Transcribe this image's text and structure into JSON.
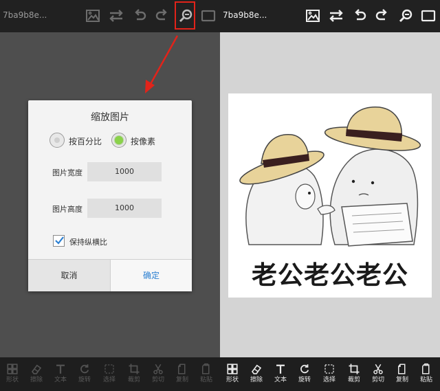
{
  "left_panel": {
    "file_name": "7ba9b8e...",
    "dialog": {
      "title": "缩放图片",
      "radio_percent_label": "按百分比",
      "radio_pixel_label": "按像素",
      "selected_mode": "按像素",
      "width_label": "图片宽度",
      "width_value": "1000",
      "height_label": "图片高度",
      "height_value": "1000",
      "keep_ratio_label": "保持纵横比",
      "keep_ratio_checked": true,
      "cancel_label": "取消",
      "ok_label": "确定"
    },
    "highlight_color": "#e2231a",
    "toolbar_icons": [
      "image-icon",
      "swap-icon",
      "undo-icon",
      "redo-icon",
      "zoom-icon",
      "crop-frame-icon"
    ]
  },
  "right_panel": {
    "file_name": "7ba9b8e...",
    "image_caption": "老公老公老公"
  },
  "bottom_tools": [
    {
      "label": "形状",
      "icon": "grid-icon"
    },
    {
      "label": "擦除",
      "icon": "eraser-icon"
    },
    {
      "label": "文本",
      "icon": "text-icon"
    },
    {
      "label": "旋转",
      "icon": "rotate-icon"
    },
    {
      "label": "选择",
      "icon": "select-icon"
    },
    {
      "label": "裁剪",
      "icon": "crop-icon"
    },
    {
      "label": "剪切",
      "icon": "scissors-icon"
    },
    {
      "label": "复制",
      "icon": "copy-icon"
    },
    {
      "label": "粘贴",
      "icon": "paste-icon"
    }
  ],
  "colors": {
    "accent_blue": "#2a7fd2",
    "radio_selected": "#8ad24a"
  }
}
